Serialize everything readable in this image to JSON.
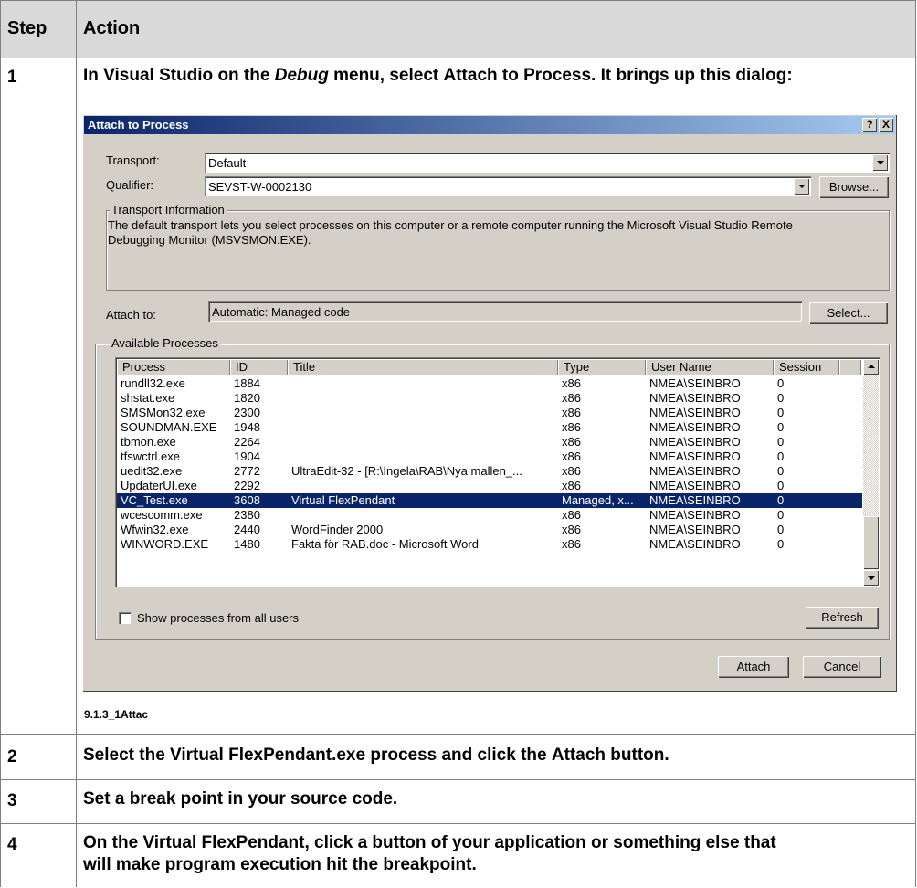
{
  "table": {
    "headers": {
      "step": "Step",
      "action": "Action"
    },
    "rows": [
      {
        "step": "1",
        "action_parts": [
          "In Visual Studio on the ",
          "Debug",
          " menu, select ",
          "Attach to Process",
          ". It brings up this dialog:"
        ]
      },
      {
        "step": "2",
        "action_parts": [
          "Select the ",
          "Virtual FlexPendant.exe",
          " process and click the ",
          "Attach",
          " button."
        ]
      },
      {
        "step": "3",
        "action": "Set a break point in your source code."
      },
      {
        "step": "4",
        "action_lines": [
          "On the Virtual FlexPendant, click a button of your application or something else that",
          "will make program execution hit the breakpoint."
        ]
      }
    ]
  },
  "figure_caption": "9.1.3_1Attac",
  "dialog": {
    "title": "Attach to Process",
    "help_button": "?",
    "close_button": "X",
    "transport": {
      "label": "Transport:",
      "value": "Default"
    },
    "qualifier": {
      "label": "Qualifier:",
      "value": "SEVST-W-0002130",
      "browse_button": "Browse..."
    },
    "transport_info": {
      "title": "Transport Information",
      "lines": [
        "The default transport lets you select processes on this computer or a remote computer running the Microsoft Visual Studio Remote",
        "Debugging Monitor (MSVSMON.EXE)."
      ]
    },
    "attach_to": {
      "label": "Attach to:",
      "value": "Automatic: Managed code",
      "select_button": "Select..."
    },
    "available_processes": {
      "title": "Available Processes",
      "columns": [
        "Process",
        "ID",
        "Title",
        "Type",
        "User Name",
        "Session"
      ],
      "rows": [
        [
          "rundll32.exe",
          "1884",
          "",
          "x86",
          "NMEA\\SEINBRO",
          "0"
        ],
        [
          "shstat.exe",
          "1820",
          "",
          "x86",
          "NMEA\\SEINBRO",
          "0"
        ],
        [
          "SMSMon32.exe",
          "2300",
          "",
          "x86",
          "NMEA\\SEINBRO",
          "0"
        ],
        [
          "SOUNDMAN.EXE",
          "1948",
          "",
          "x86",
          "NMEA\\SEINBRO",
          "0"
        ],
        [
          "tbmon.exe",
          "2264",
          "",
          "x86",
          "NMEA\\SEINBRO",
          "0"
        ],
        [
          "tfswctrl.exe",
          "1904",
          "",
          "x86",
          "NMEA\\SEINBRO",
          "0"
        ],
        [
          "uedit32.exe",
          "2772",
          "UltraEdit-32 - [R:\\Ingela\\RAB\\Nya mallen_...",
          "x86",
          "NMEA\\SEINBRO",
          "0"
        ],
        [
          "UpdaterUI.exe",
          "2292",
          "",
          "x86",
          "NMEA\\SEINBRO",
          "0"
        ],
        [
          "VC_Test.exe",
          "3608",
          "Virtual FlexPendant",
          "Managed, x...",
          "NMEA\\SEINBRO",
          "0"
        ],
        [
          "wcescomm.exe",
          "2380",
          "",
          "x86",
          "NMEA\\SEINBRO",
          "0"
        ],
        [
          "Wfwin32.exe",
          "2440",
          "WordFinder 2000",
          "x86",
          "NMEA\\SEINBRO",
          "0"
        ],
        [
          "WINWORD.EXE",
          "1480",
          "Fakta för RAB.doc - Microsoft Word",
          "x86",
          "NMEA\\SEINBRO",
          "0"
        ]
      ],
      "selected_row": 8,
      "show_all_users_label": "Show processes from all users",
      "show_all_users_checked": false,
      "refresh_button": "Refresh"
    },
    "attach_button": "Attach",
    "cancel_button": "Cancel"
  },
  "colors": {
    "titlebar_start": "#0a246a",
    "titlebar_end": "#a6caf0",
    "dialog_face": "#d4d0c8",
    "selection": "#0a246a",
    "header_band": "#d9d9d9"
  }
}
